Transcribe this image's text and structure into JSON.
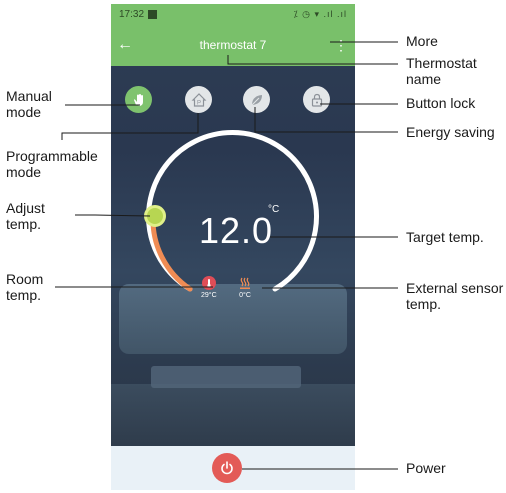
{
  "status_bar": {
    "time": "17:32",
    "indicators": "⁒ ◷ ▾ .ıl .ıl"
  },
  "app_bar": {
    "back_icon": "arrow-left-icon",
    "title": "thermostat 7",
    "more_icon": "more-vertical-icon"
  },
  "mode_buttons": [
    {
      "name": "Manual mode",
      "icon": "hand-icon",
      "active": true
    },
    {
      "name": "Programmable mode",
      "icon": "p-house-icon",
      "active": false
    },
    {
      "name": "Energy saving",
      "icon": "leaf-icon",
      "active": false
    },
    {
      "name": "Button lock",
      "icon": "lock-icon",
      "active": false
    }
  ],
  "dial": {
    "target_temp": "12.0",
    "unit": "°C",
    "room_temp": "29°C",
    "external_temp": "0°C",
    "arc_color": "#ffffff",
    "warm_color": "#f08c54"
  },
  "power": {
    "icon": "power-icon",
    "color": "#e35b57"
  },
  "callouts": {
    "more": "More",
    "thermostat_name_1": "Thermostat",
    "thermostat_name_2": "name",
    "button_lock": "Button lock",
    "energy_saving": "Energy saving",
    "manual_mode_1": "Manual",
    "manual_mode_2": "mode",
    "programmable_1": "Programmable",
    "programmable_2": "mode",
    "adjust_1": "Adjust",
    "adjust_2": "temp.",
    "target_temp": "Target temp.",
    "room_1": "Room",
    "room_2": "temp.",
    "external_1": "External sensor",
    "external_2": "temp.",
    "power": "Power"
  },
  "colors": {
    "app_green": "#79c06a",
    "active_mode": "#7fc36e"
  }
}
